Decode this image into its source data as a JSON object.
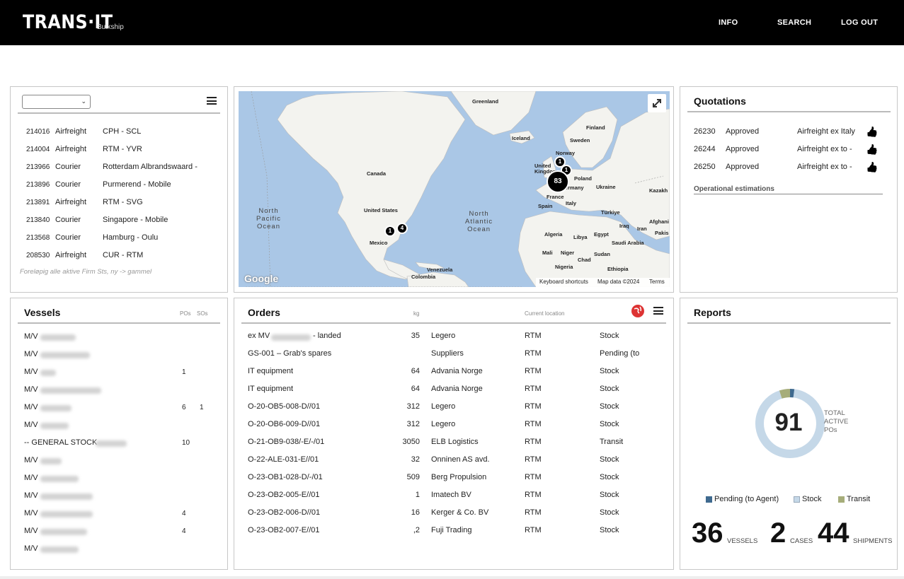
{
  "header": {
    "logo": "TRANS·IT",
    "logo_sub": "Bulkship",
    "nav": [
      "INFO",
      "SEARCH",
      "LOG OUT"
    ]
  },
  "shipments": {
    "dropdown_value": "",
    "rows": [
      {
        "id": "214016",
        "type": "Airfreight",
        "route": "CPH - SCL"
      },
      {
        "id": "214004",
        "type": "Airfreight",
        "route": "RTM - YVR"
      },
      {
        "id": "213966",
        "type": "Courier",
        "route": "Rotterdam Albrandswaard -"
      },
      {
        "id": "213896",
        "type": "Courier",
        "route": "Purmerend - Mobile"
      },
      {
        "id": "213891",
        "type": "Airfreight",
        "route": "RTM - SVG"
      },
      {
        "id": "213840",
        "type": "Courier",
        "route": "Singapore - Mobile"
      },
      {
        "id": "213568",
        "type": "Courier",
        "route": "Hamburg - Oulu"
      },
      {
        "id": "208530",
        "type": "Airfreight",
        "route": "CUR - RTM"
      }
    ],
    "note": "Foreløpig alle aktive Firm Sts, ny -> gammel"
  },
  "map": {
    "labels": {
      "greenland": "Greenland",
      "iceland": "Iceland",
      "finland": "Finland",
      "sweden": "Sweden",
      "norway": "Norway",
      "uk": "United Kingdom",
      "poland": "Poland",
      "ukraine": "Ukraine",
      "kazakh": "Kazakh",
      "germany": "Germany",
      "france": "France",
      "spain": "Spain",
      "italy": "Italy",
      "turkiye": "Türkiye",
      "iraq": "Iraq",
      "iran": "Iran",
      "afghan": "Afghani",
      "pakis": "Pakis",
      "algeria": "Algeria",
      "libya": "Libya",
      "egypt": "Egypt",
      "saudi": "Saudi Arabia",
      "mali": "Mali",
      "niger": "Niger",
      "chad": "Chad",
      "sudan": "Sudan",
      "nigeria": "Nigeria",
      "ethiopia": "Ethiopia",
      "canada": "Canada",
      "us": "United States",
      "mexico": "Mexico",
      "venezuela": "Venezuela",
      "colombia": "Colombia"
    },
    "ocean_north_pacific": [
      "North",
      "Pacific",
      "Ocean"
    ],
    "ocean_north_atlantic": [
      "North",
      "Atlantic",
      "Ocean"
    ],
    "clusters": [
      "1",
      "1",
      "83",
      "1",
      "4"
    ],
    "google": "Google",
    "footer": [
      "Keyboard shortcuts",
      "Map data ©2024",
      "Terms"
    ]
  },
  "quotations": {
    "title": "Quotations",
    "rows": [
      {
        "id": "26230",
        "status": "Approved",
        "desc": "Airfreight ex Italy"
      },
      {
        "id": "26244",
        "status": "Approved",
        "desc": "Airfreight ex  to  -"
      },
      {
        "id": "26250",
        "status": "Approved",
        "desc": "Airfreight ex  to  -"
      }
    ],
    "link": "Operational estimations"
  },
  "vessels": {
    "title": "Vessels",
    "col_pos": "POs",
    "col_sos": "SOs",
    "rows": [
      {
        "prefix": "M/V",
        "pos": "",
        "sos": ""
      },
      {
        "prefix": "M/V",
        "pos": "",
        "sos": ""
      },
      {
        "prefix": "M/V",
        "pos": "1",
        "sos": ""
      },
      {
        "prefix": "M/V",
        "pos": "",
        "sos": ""
      },
      {
        "prefix": "M/V",
        "pos": "6",
        "sos": "1"
      },
      {
        "prefix": "M/V",
        "pos": "",
        "sos": ""
      },
      {
        "prefix": "-- GENERAL STOCK",
        "pos": "10",
        "sos": ""
      },
      {
        "prefix": "M/V",
        "pos": "",
        "sos": ""
      },
      {
        "prefix": "M/V",
        "pos": "",
        "sos": ""
      },
      {
        "prefix": "M/V",
        "pos": "",
        "sos": ""
      },
      {
        "prefix": "M/V",
        "pos": "4",
        "sos": ""
      },
      {
        "prefix": "M/V",
        "pos": "4",
        "sos": ""
      },
      {
        "prefix": "M/V",
        "pos": "",
        "sos": ""
      }
    ]
  },
  "orders": {
    "title": "Orders",
    "col_kg": "kg",
    "col_loc": "Current location",
    "rows": [
      {
        "name": "ex MV",
        "name_suffix": "- landed",
        "kg": "35",
        "supplier": "Legero",
        "loc": "RTM",
        "status": "Stock"
      },
      {
        "name": "GS-001 – Grab's spares",
        "name_suffix": "",
        "kg": "",
        "supplier": "Suppliers",
        "loc": "RTM",
        "status": "Pending (to"
      },
      {
        "name": "IT equipment",
        "name_suffix": "",
        "kg": "64",
        "supplier": "Advania Norge",
        "loc": "RTM",
        "status": "Stock"
      },
      {
        "name": "IT equipment",
        "name_suffix": "",
        "kg": "64",
        "supplier": "Advania Norge",
        "loc": "RTM",
        "status": "Stock"
      },
      {
        "name": "O-20-OB5-008-D//01",
        "name_suffix": "",
        "kg": "312",
        "supplier": "Legero",
        "loc": "RTM",
        "status": "Stock"
      },
      {
        "name": "O-20-OB6-009-D//01",
        "name_suffix": "",
        "kg": "312",
        "supplier": "Legero",
        "loc": "RTM",
        "status": "Stock"
      },
      {
        "name": "O-21-OB9-038/-E/-/01",
        "name_suffix": "",
        "kg": "3050",
        "supplier": "ELB Logistics",
        "loc": "RTM",
        "status": "Transit"
      },
      {
        "name": "O-22-ALE-031-E//01",
        "name_suffix": "",
        "kg": "32",
        "supplier": "Onninen AS avd.",
        "loc": "RTM",
        "status": "Stock"
      },
      {
        "name": "O-23-OB1-028-D/-/01",
        "name_suffix": "",
        "kg": "509",
        "supplier": "Berg Propulsion",
        "loc": "RTM",
        "status": "Stock"
      },
      {
        "name": "O-23-OB2-005-E//01",
        "name_suffix": "",
        "kg": "1",
        "supplier": "Imatech BV",
        "loc": "RTM",
        "status": "Stock"
      },
      {
        "name": "O-23-OB2-006-D//01",
        "name_suffix": "",
        "kg": "16",
        "supplier": "Kerger & Co. BV",
        "loc": "RTM",
        "status": "Stock"
      },
      {
        "name": "O-23-OB2-007-E//01",
        "name_suffix": "",
        "kg": ",2",
        "supplier": "Fuji Trading",
        "loc": "RTM",
        "status": "Stock"
      }
    ]
  },
  "reports": {
    "title": "Reports",
    "total": "91",
    "total_label": [
      "TOTAL",
      "ACTIVE",
      "POs"
    ],
    "legend": [
      {
        "label": "Pending (to Agent)",
        "color": "#3f6a8f"
      },
      {
        "label": "Stock",
        "color": "#c5d8e8"
      },
      {
        "label": "Transit",
        "color": "#a6ad7a"
      }
    ],
    "donut_fractions": {
      "pending": 0.02,
      "stock": 0.93,
      "transit": 0.05
    },
    "stats": [
      {
        "value": "36",
        "label": "VESSELS"
      },
      {
        "value": "2",
        "label": "CASES"
      },
      {
        "value": "44",
        "label": "SHIPMENTS"
      }
    ]
  }
}
